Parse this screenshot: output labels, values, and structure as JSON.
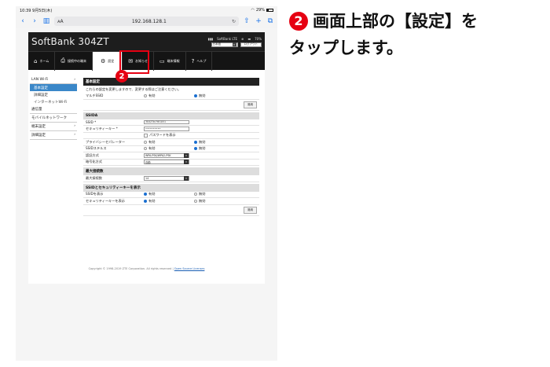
{
  "device": {
    "time": "10:39",
    "date": "9月5日(木)",
    "battery": "29%"
  },
  "safari": {
    "back": "‹",
    "forward": "›",
    "aa": "ᴀA",
    "address": "192.168.128.1",
    "reload": "↻",
    "share": "⇧",
    "new_tab": "+",
    "tabs": "⧉"
  },
  "router": {
    "logo": "SoftBank 304ZT",
    "carrier": "SoftBank LTE",
    "battery": "70%",
    "language": "日本語",
    "logout": "ログアウト",
    "menu": [
      {
        "icon": "⌂",
        "label": "ホーム"
      },
      {
        "icon": "⎙",
        "label": "接続中の端末"
      },
      {
        "icon": "⚙",
        "label": "設定"
      },
      {
        "icon": "✉",
        "label": "お知らせ"
      },
      {
        "icon": "▭",
        "label": "端末情報"
      },
      {
        "icon": "?",
        "label": "ヘルプ"
      }
    ],
    "sidebar": {
      "lan_wifi": "LAN Wi-Fi",
      "basic": "基本設定",
      "detail": "詳細設定",
      "internet_wifi": "インターネットWi-Fi",
      "traffic": "通信量",
      "mobile_network": "モバイルネットワーク",
      "advanced": "端末設定",
      "detailed_settings": "詳細設定"
    },
    "basic_section": "基本設定",
    "notice": "これらの設定を変更しますので、変更する際はご注意ください。",
    "multi_ssid": "マルチSSID",
    "enabled": "有効",
    "disabled": "無効",
    "apply": "適用",
    "ssid_section": "SSIDA",
    "ssid_label": "SSID *",
    "ssid_value": "304ZTa-F6G051",
    "security_key_label": "セキュリティーキー *",
    "security_key_value": "••••••••••",
    "show_password": "パスワードを表示",
    "privacy_sep": "プライバシーセパレーター",
    "ssid_stealth": "SSIDステルス",
    "auth_method": "認証方式",
    "auth_value": "WPA-PSK/WPA2-PSK",
    "encryption": "暗号化方式",
    "encryption_value": "自動",
    "max_conn_section": "最大接続数",
    "max_conn_label": "最大接続数",
    "max_conn_value": "14",
    "ssid_key_section": "SSIDとセキュリティーキーを表示",
    "show_ssid": "SSIDを表示",
    "show_key": "セキュリティーキーを表示",
    "copyright": "Copyright © 1998-2019 ZTE Corporation. All rights reserved |",
    "license": "Open Source Licenses"
  },
  "instruction": {
    "step": "2",
    "line1": "画面上部の【設定】を",
    "line2": "タップします。"
  },
  "colors": {
    "accent": "#e60012",
    "header": "#1d1d1d",
    "link": "#1a6fd1"
  }
}
